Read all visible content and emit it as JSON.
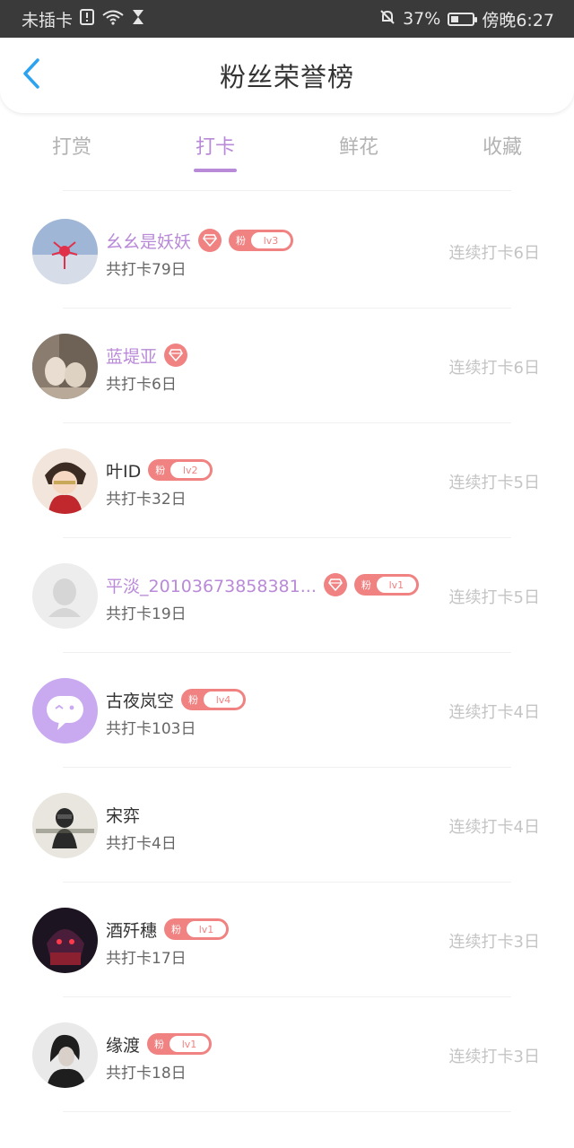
{
  "status_bar": {
    "carrier": "未插卡",
    "battery_percent": "37%",
    "battery_level": 0.37,
    "time": "傍晚6:27"
  },
  "header": {
    "title": "粉丝荣誉榜",
    "back_icon": "chevron-left-icon"
  },
  "tabs": [
    {
      "label": "打赏",
      "active": false
    },
    {
      "label": "打卡",
      "active": true
    },
    {
      "label": "鲜花",
      "active": false
    },
    {
      "label": "收藏",
      "active": false
    }
  ],
  "colors": {
    "accent": "#b98ad8",
    "badge": "#f08282",
    "back_arrow": "#2ba3f0"
  },
  "fan_badge_text": "粉",
  "rows": [
    {
      "name": "幺幺是妖妖",
      "vip": true,
      "level": "lv3",
      "total": "共打卡79日",
      "streak": "连续打卡6日"
    },
    {
      "name": "蓝堤亚",
      "vip": true,
      "level": "",
      "total": "共打卡6日",
      "streak": "连续打卡6日"
    },
    {
      "name": "叶ID",
      "vip": false,
      "level": "lv2",
      "total": "共打卡32日",
      "streak": "连续打卡5日"
    },
    {
      "name": "平淡_20103673858381...",
      "vip": true,
      "level": "lv1",
      "total": "共打卡19日",
      "streak": "连续打卡5日"
    },
    {
      "name": "古夜岚空",
      "vip": false,
      "level": "lv4",
      "total": "共打卡103日",
      "streak": "连续打卡4日"
    },
    {
      "name": "宋弈",
      "vip": false,
      "level": "",
      "total": "共打卡4日",
      "streak": "连续打卡4日"
    },
    {
      "name": "酒歼穗",
      "vip": false,
      "level": "lv1",
      "total": "共打卡17日",
      "streak": "连续打卡3日"
    },
    {
      "name": "缘渡",
      "vip": false,
      "level": "lv1",
      "total": "共打卡18日",
      "streak": "连续打卡3日"
    }
  ]
}
